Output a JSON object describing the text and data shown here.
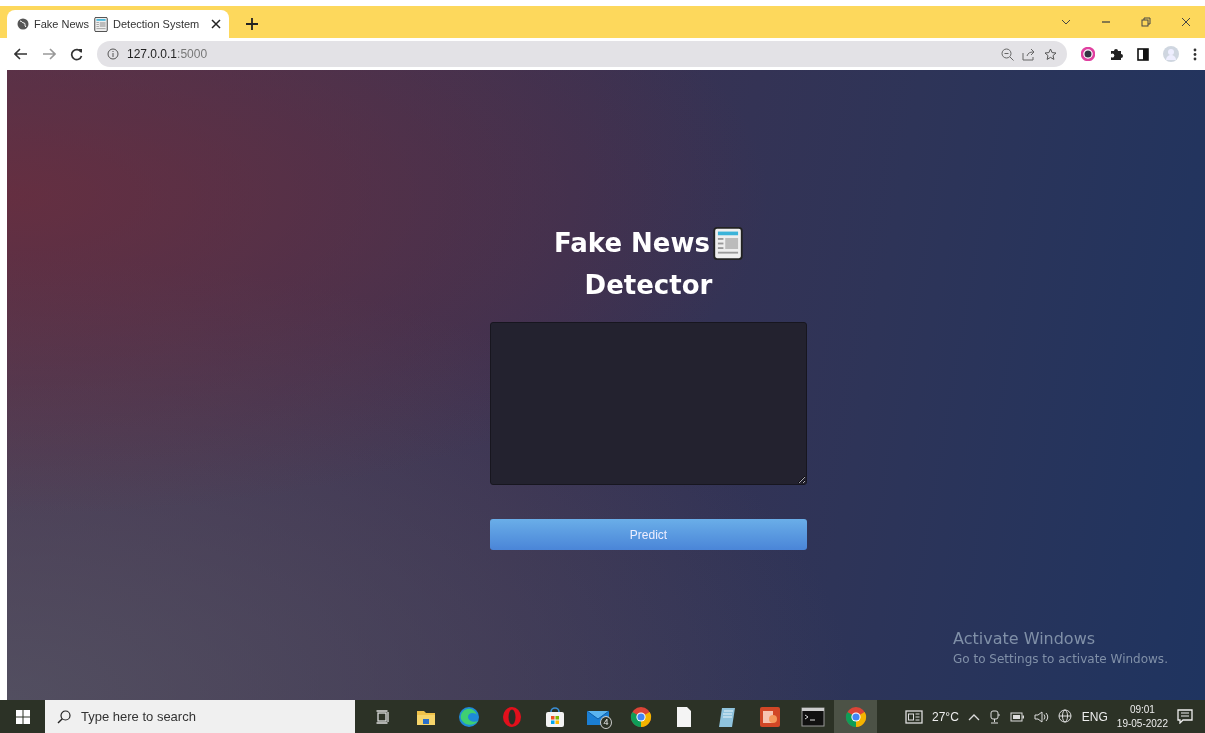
{
  "browser": {
    "tab": {
      "title_start": "Fake News",
      "title_end": "Detection System"
    },
    "address_host": "127.0.0.1",
    "address_port": ":5000"
  },
  "page": {
    "title_line_1": "Fake News",
    "title_line_2": "Detector",
    "button": "Predict"
  },
  "watermark": {
    "title": "Activate Windows",
    "subtitle": "Go to Settings to activate Windows."
  },
  "taskbar": {
    "search_placeholder": "Type here to search",
    "apps": [
      {
        "kind": "task-view",
        "selected": false
      },
      {
        "kind": "folder",
        "selected": false
      },
      {
        "kind": "edge",
        "selected": false
      },
      {
        "kind": "opera",
        "selected": false
      },
      {
        "kind": "store",
        "selected": false
      },
      {
        "kind": "mail",
        "selected": false,
        "badge": "4"
      },
      {
        "kind": "chrome",
        "selected": false
      },
      {
        "kind": "file",
        "selected": false
      },
      {
        "kind": "notepad",
        "selected": false
      },
      {
        "kind": "slides",
        "selected": false
      },
      {
        "kind": "terminal",
        "selected": false
      },
      {
        "kind": "chrome",
        "selected": true
      }
    ],
    "weather": "27°C",
    "language": "ENG",
    "time": "09:01",
    "date": "19-05-2022"
  }
}
